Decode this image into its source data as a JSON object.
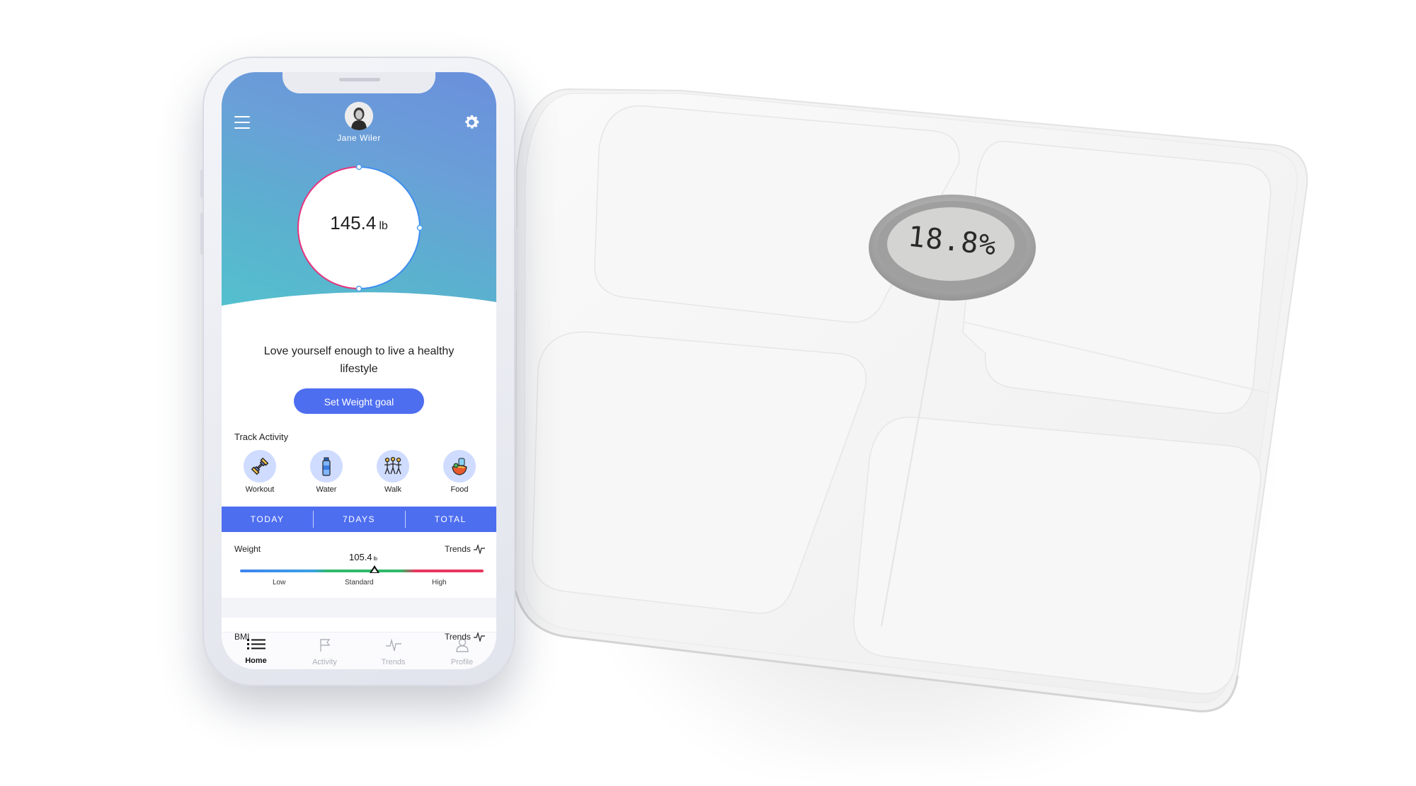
{
  "scale": {
    "display_reading": "18.8%"
  },
  "phone": {
    "user_name": "Jane Wiler",
    "current_weight": {
      "value": "145.4",
      "unit": "lb"
    },
    "quote": "Love yourself enough to live a healthy lifestyle",
    "set_goal_label": "Set Weight goal",
    "track_activity": {
      "title": "Track Activity",
      "items": [
        {
          "label": "Workout",
          "icon": "dumbbell-icon"
        },
        {
          "label": "Water",
          "icon": "water-bottle-icon"
        },
        {
          "label": "Walk",
          "icon": "walk-icon"
        },
        {
          "label": "Food",
          "icon": "food-icon"
        }
      ]
    },
    "tabs": [
      "TODAY",
      "7DAYS",
      "TOTAL"
    ],
    "weight_metric": {
      "label": "Weight",
      "trends_label": "Trends",
      "value": "105.4",
      "unit": "lb",
      "ranges": [
        "Low",
        "Standard",
        "High"
      ]
    },
    "bmi_metric": {
      "label": "BMI",
      "trends_label": "Trends"
    },
    "bottom_nav": [
      {
        "label": "Home",
        "icon": "list-icon",
        "active": true
      },
      {
        "label": "Activity",
        "icon": "flag-icon",
        "active": false
      },
      {
        "label": "Trends",
        "icon": "pulse-icon",
        "active": false
      },
      {
        "label": "Profile",
        "icon": "person-icon",
        "active": false
      }
    ],
    "colors": {
      "accent": "#4e6ef0",
      "gradient_top": "#6a8fdc",
      "gradient_bottom": "#53c2cd",
      "ring_blue": "#3f8df0",
      "ring_pink": "#e8337d"
    }
  }
}
